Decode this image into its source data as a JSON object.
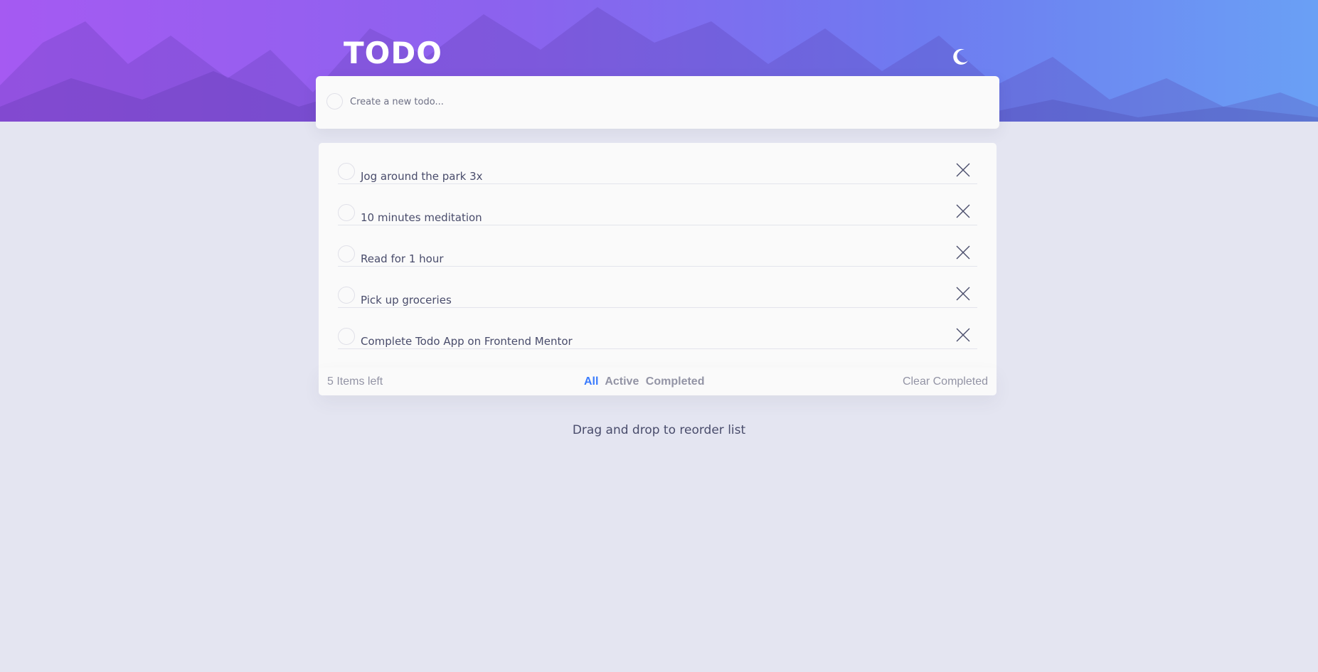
{
  "header": {
    "title": "TODO",
    "theme_icon": "moon-icon"
  },
  "new_todo": {
    "placeholder": "Create a new todo..."
  },
  "todos": [
    {
      "text": "Jog around the park 3x",
      "completed": false
    },
    {
      "text": "10 minutes meditation",
      "completed": false
    },
    {
      "text": "Read for 1 hour",
      "completed": false
    },
    {
      "text": "Pick up groceries",
      "completed": false
    },
    {
      "text": "Complete Todo App on Frontend Mentor",
      "completed": false
    }
  ],
  "footer": {
    "items_left": "5 Items left",
    "filters": [
      "All",
      "Active",
      "Completed"
    ],
    "active_filter": "All",
    "clear_label": "Clear Completed"
  },
  "hint": "Drag and drop to reorder list",
  "colors": {
    "accent": "#3a7bfd",
    "background": "#e4e5f1",
    "card": "#fafafa",
    "text": "#494c6b",
    "muted": "#9394a5"
  }
}
